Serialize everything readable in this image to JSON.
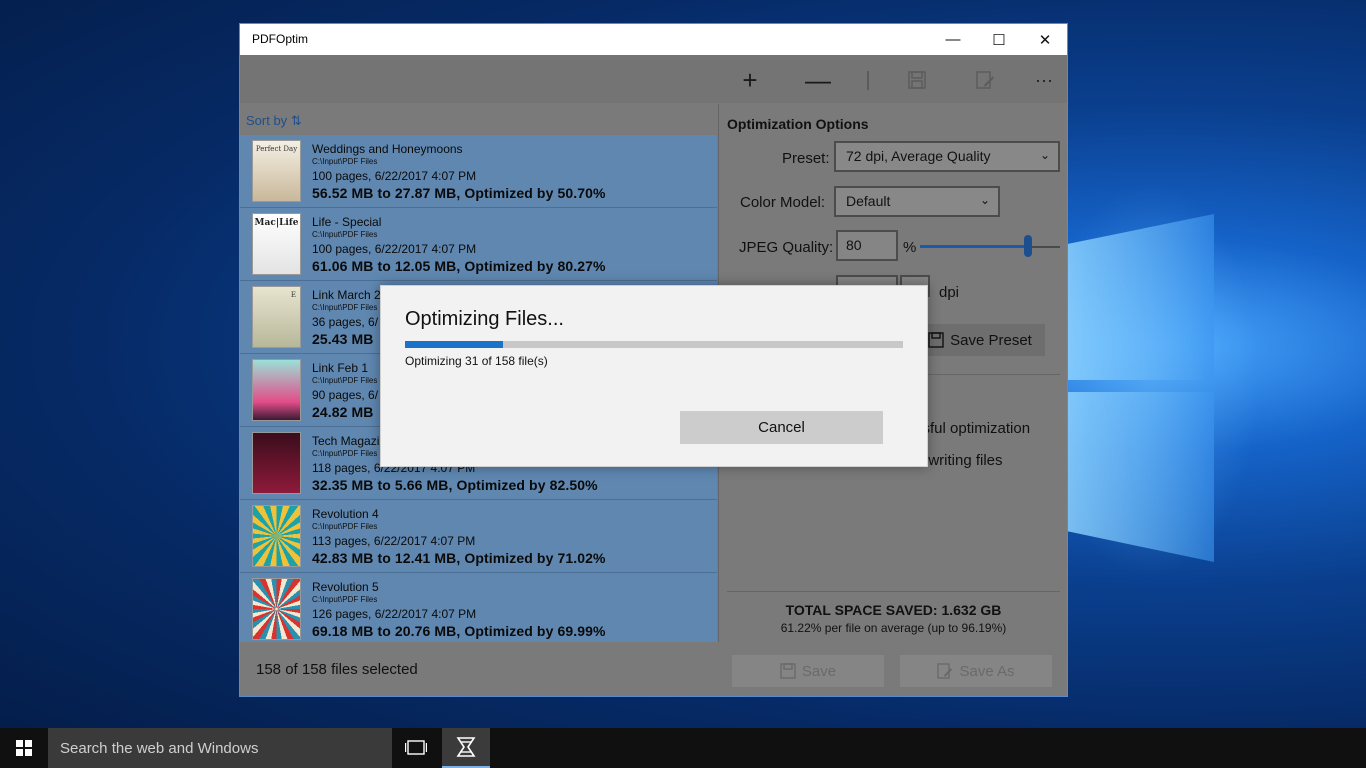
{
  "window": {
    "title": "PDFOptim",
    "minimize_glyph": "—",
    "maximize_glyph": "☐",
    "close_glyph": "✕"
  },
  "toolbar": {
    "add_glyph": "+",
    "remove_glyph": "—",
    "more_glyph": "···",
    "icons": [
      "add-icon",
      "remove-icon",
      "save-icon",
      "edit-icon",
      "more-icon"
    ]
  },
  "list": {
    "sort_label": "Sort by",
    "sort_glyph": "⇅",
    "files": [
      {
        "name": "Weddings and Honeymoons",
        "path": "C:\\Input\\PDF Files",
        "pages": "100 pages, 6/22/2017 4:07 PM",
        "result": "56.52 MB to 27.87 MB, Optimized by 50.70%",
        "thumb_text": "Perfect Day"
      },
      {
        "name": "Life - Special",
        "path": "C:\\Input\\PDF Files",
        "pages": "100 pages, 6/22/2017 4:07 PM",
        "result": "61.06 MB to 12.05 MB, Optimized by 80.27%",
        "thumb_text": "Mac|Life"
      },
      {
        "name": "Link March 2",
        "path": "C:\\Input\\PDF Files",
        "pages": "36 pages, 6/",
        "result": "25.43 MB",
        "thumb_text": "E"
      },
      {
        "name": "Link Feb 1",
        "path": "C:\\Input\\PDF Files",
        "pages": "90 pages, 6/",
        "result": "24.82 MB",
        "thumb_text": ""
      },
      {
        "name": "Tech Magazin",
        "path": "C:\\Input\\PDF Files",
        "pages": "118 pages, 6/22/2017 4:07 PM",
        "result": "32.35 MB to 5.66 MB, Optimized by 82.50%",
        "thumb_text": ""
      },
      {
        "name": "Revolution 4",
        "path": "C:\\Input\\PDF Files",
        "pages": "113 pages, 6/22/2017 4:07 PM",
        "result": "42.83 MB to 12.41 MB, Optimized by 71.02%",
        "thumb_text": ""
      },
      {
        "name": "Revolution 5",
        "path": "C:\\Input\\PDF Files",
        "pages": "126 pages, 6/22/2017 4:07 PM",
        "result": "69.18 MB to 20.76 MB, Optimized by 69.99%",
        "thumb_text": ""
      }
    ]
  },
  "options": {
    "heading": "Optimization Options",
    "preset_label": "Preset:",
    "preset_value": "72 dpi, Average Quality",
    "color_label": "Color Model:",
    "color_value": "Default",
    "jpeg_label": "JPEG Quality:",
    "jpeg_value": "80",
    "jpeg_unit": "%",
    "jpeg_slider_level": 0.8,
    "dpi_unit": "dpi",
    "save_preset_label": "Save Preset",
    "check1_partial": "ssful optimization",
    "check2_partial": "erwriting files",
    "total_saved": "TOTAL SPACE SAVED: 1.632 GB",
    "average_text": "61.22% per file on average (up to 96.19%)"
  },
  "bottom": {
    "selected_text": "158 of 158 files selected",
    "save_label": "Save",
    "save_as_label": "Save As"
  },
  "dialog": {
    "title": "Optimizing Files...",
    "status": "Optimizing 31 of 158 file(s)",
    "progress": 0.196,
    "cancel_label": "Cancel"
  },
  "taskbar": {
    "search_placeholder": "Search the web and Windows"
  },
  "colors": {
    "accent": "#1a73c9",
    "list_selected": "#5f87b0",
    "taskbar": "#101010"
  }
}
